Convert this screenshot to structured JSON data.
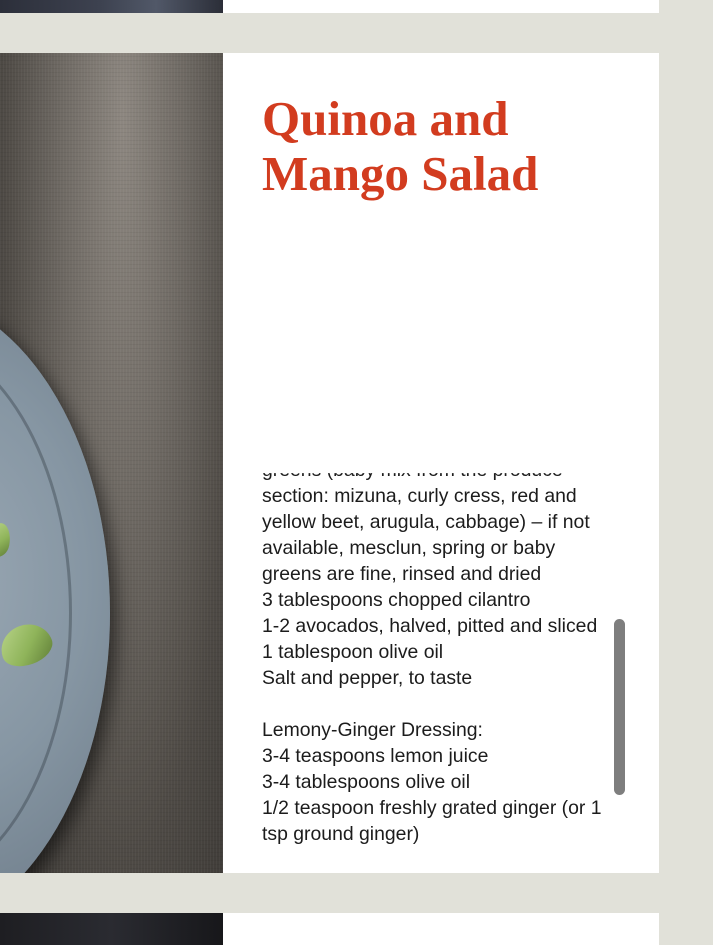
{
  "recipe": {
    "title": "Quinoa and Mango Salad",
    "ingredients_visible": [
      "section: mizuna, curly cress, red and",
      "yellow beet, arugula, cabbage) – if not",
      "available, mesclun, spring or baby",
      "greens are fine, rinsed and dried",
      "3 tablespoons chopped cilantro",
      "1-2 avocados, halved, pitted and sliced",
      "1 tablespoon olive oil",
      "Salt and pepper, to taste"
    ],
    "dressing_heading": "Lemony-Ginger Dressing:",
    "dressing_items": [
      "3-4 teaspoons lemon juice",
      "3-4 tablespoons olive oil",
      "1/2 teaspoon freshly grated ginger (or 1",
      "tsp ground ginger)"
    ]
  }
}
